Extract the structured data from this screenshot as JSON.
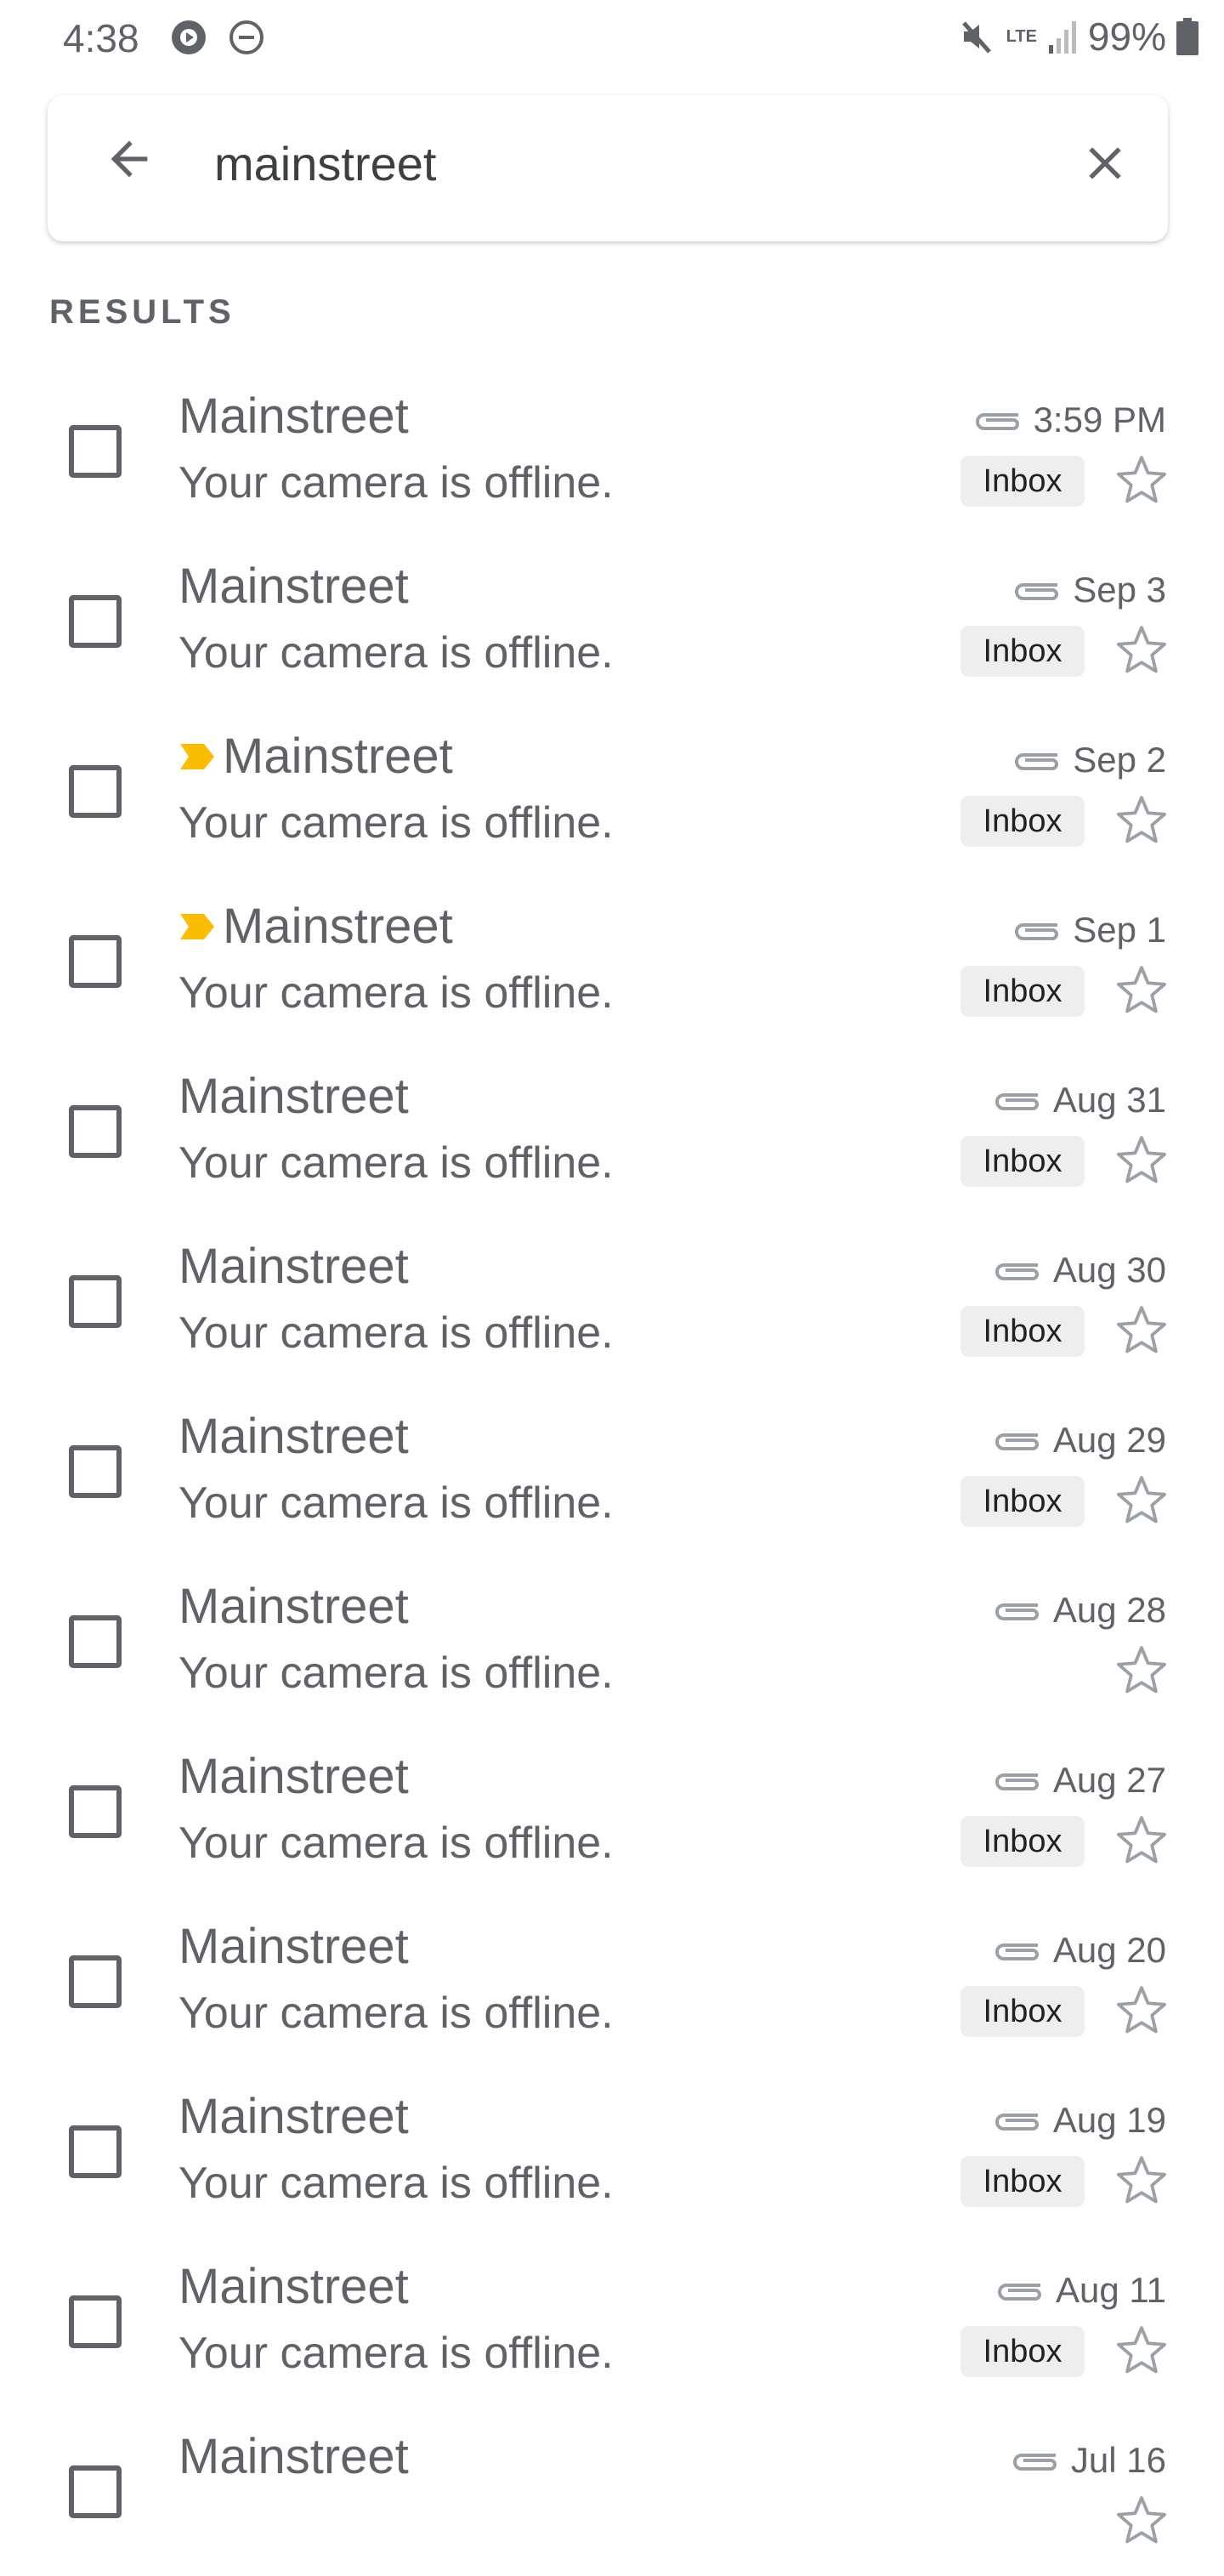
{
  "status_bar": {
    "time": "4:38",
    "network": "LTE",
    "battery": "99%"
  },
  "search": {
    "query": "mainstreet"
  },
  "results_label": "RESULTS",
  "colors": {
    "important": "#fbbc04",
    "text": "#5f6368",
    "chip_bg": "#eeeeee"
  },
  "emails": [
    {
      "sender": "Mainstreet",
      "snippet": "Your camera is offline.",
      "date": "3:59 PM",
      "label": "Inbox",
      "important": false
    },
    {
      "sender": "Mainstreet",
      "snippet": "Your camera is offline.",
      "date": "Sep 3",
      "label": "Inbox",
      "important": false
    },
    {
      "sender": "Mainstreet",
      "snippet": "Your camera is offline.",
      "date": "Sep 2",
      "label": "Inbox",
      "important": true
    },
    {
      "sender": "Mainstreet",
      "snippet": "Your camera is offline.",
      "date": "Sep 1",
      "label": "Inbox",
      "important": true
    },
    {
      "sender": "Mainstreet",
      "snippet": "Your camera is offline.",
      "date": "Aug 31",
      "label": "Inbox",
      "important": false
    },
    {
      "sender": "Mainstreet",
      "snippet": "Your camera is offline.",
      "date": "Aug 30",
      "label": "Inbox",
      "important": false
    },
    {
      "sender": "Mainstreet",
      "snippet": "Your camera is offline.",
      "date": "Aug 29",
      "label": "Inbox",
      "important": false
    },
    {
      "sender": "Mainstreet",
      "snippet": "Your camera is offline.",
      "date": "Aug 28",
      "label": "",
      "important": false
    },
    {
      "sender": "Mainstreet",
      "snippet": "Your camera is offline.",
      "date": "Aug 27",
      "label": "Inbox",
      "important": false
    },
    {
      "sender": "Mainstreet",
      "snippet": "Your camera is offline.",
      "date": "Aug 20",
      "label": "Inbox",
      "important": false
    },
    {
      "sender": "Mainstreet",
      "snippet": "Your camera is offline.",
      "date": "Aug 19",
      "label": "Inbox",
      "important": false
    },
    {
      "sender": "Mainstreet",
      "snippet": "Your camera is offline.",
      "date": "Aug 11",
      "label": "Inbox",
      "important": false
    },
    {
      "sender": "Mainstreet",
      "snippet": "",
      "date": "Jul 16",
      "label": "",
      "important": false
    }
  ]
}
